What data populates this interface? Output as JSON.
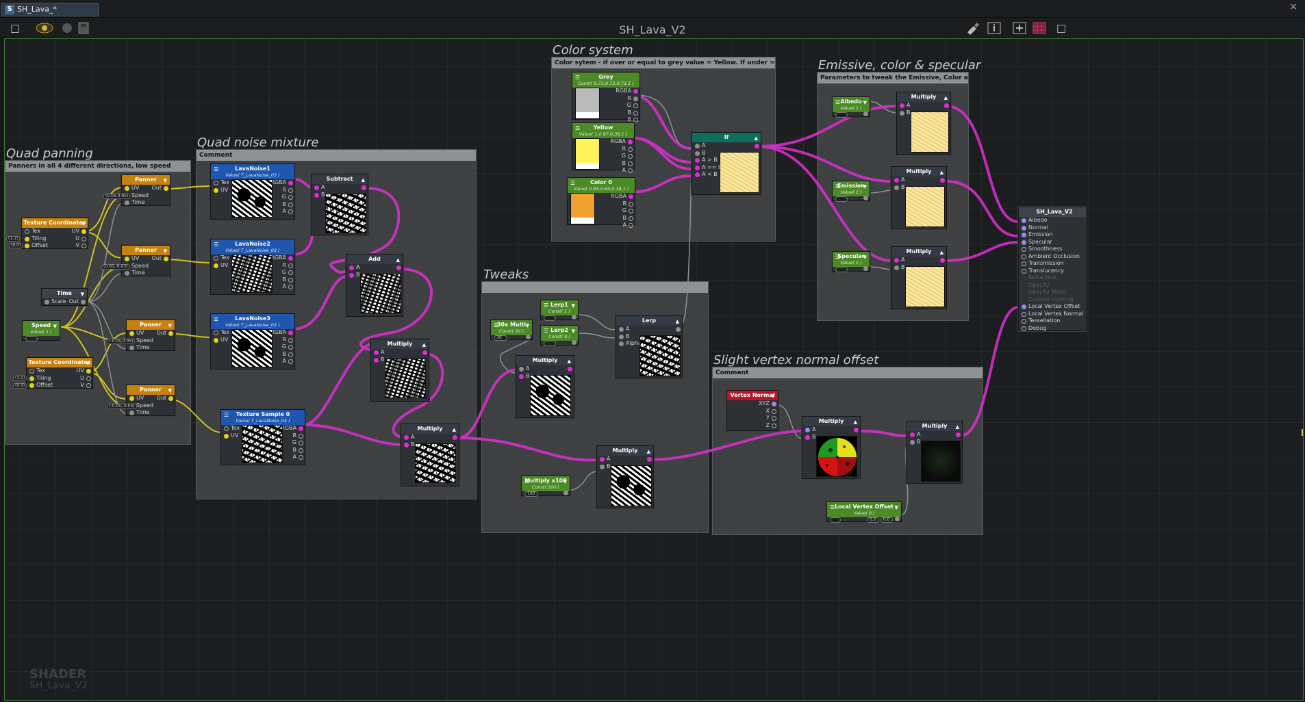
{
  "tab": {
    "label": "SH_Lava_*",
    "icon_letter": "S"
  },
  "window": {
    "close_glyph": "×"
  },
  "canvas_title": "SH_Lava_V2",
  "watermark": {
    "line1": "SHADER",
    "line2": "SH_Lava_V2"
  },
  "groups": {
    "quad_panning": {
      "title": "Quad panning",
      "comment": "Panners in all 4 different directions, low speed"
    },
    "quad_noise": {
      "title": "Quad noise mixture",
      "comment": "Comment"
    },
    "color_system": {
      "title": "Color system",
      "comment": "Color sytem - if over or equal to grey value = Yellow. If under = Orange"
    },
    "emissive": {
      "title": "Emissive, color & specular",
      "comment": "Parameters to tweak the Emissive, Color and Specular"
    },
    "tweaks": {
      "title": "Tweaks",
      "comment": ""
    },
    "vertex": {
      "title": "Slight vertex normal offset",
      "comment": "Comment"
    }
  },
  "nodes": {
    "texcoord1": {
      "title": "Texture Coordinates",
      "in": [
        "Tex",
        "Tiling",
        "Offset"
      ],
      "out": [
        "UV",
        "U",
        "V"
      ],
      "tags": [
        "(1,1)",
        "(0,0)"
      ]
    },
    "texcoord2": {
      "title": "Texture Coordinates",
      "in": [
        "Tex",
        "Tiling",
        "Offset"
      ],
      "out": [
        "UV",
        "U",
        "V"
      ],
      "tags": [
        "(1,1)",
        "(0,0)"
      ]
    },
    "time": {
      "title": "Time",
      "in": [
        "Scale"
      ],
      "out": [
        "Out"
      ]
    },
    "speed": {
      "title": "Speed",
      "sub": "Value( 1 )"
    },
    "panner1": {
      "title": "Panner",
      "in": [
        "UV",
        "Speed",
        "Time"
      ],
      "out": "Out",
      "tag": "(0.05,0.05)"
    },
    "panner2": {
      "title": "Panner",
      "in": [
        "UV",
        "Speed",
        "Time"
      ],
      "out": "Out",
      "tag": "(0.05,-0.05)"
    },
    "panner3": {
      "title": "Panner",
      "in": [
        "UV",
        "Speed",
        "Time"
      ],
      "out": "Out",
      "tag": "(-0.05,0.05)"
    },
    "panner4": {
      "title": "Panner",
      "in": [
        "UV",
        "Speed",
        "Time"
      ],
      "out": "Out",
      "tag": "(-0.05,-0.05)"
    },
    "lava1": {
      "title": "LavaNoise1",
      "sub": "Value( T_LavaNoise_03 )",
      "in": [
        "Tex",
        "UV"
      ],
      "out": [
        "RGBA",
        "R",
        "G",
        "B",
        "A"
      ]
    },
    "lava2": {
      "title": "LavaNoise2",
      "sub": "Value( T_LavaNoise_03 )",
      "in": [
        "Tex",
        "UV"
      ],
      "out": [
        "RGBA",
        "R",
        "G",
        "B",
        "A"
      ]
    },
    "lava3": {
      "title": "LavaNoise3",
      "sub": "Value( T_LavaNoise_03 )",
      "in": [
        "Tex",
        "UV"
      ],
      "out": [
        "RGBA",
        "R",
        "G",
        "B",
        "A"
      ]
    },
    "texsample0": {
      "title": "Texture Sample 0",
      "sub": "Value( T_LavaNoise_03 )",
      "in": [
        "Tex",
        "UV"
      ],
      "out": [
        "RGBA",
        "R",
        "G",
        "B",
        "A"
      ]
    },
    "subtract": {
      "title": "Subtract",
      "in": [
        "A",
        "B"
      ]
    },
    "add": {
      "title": "Add",
      "in": [
        "A",
        "B"
      ]
    },
    "multiply_noise1": {
      "title": "Multiply",
      "in": [
        "A",
        "B"
      ]
    },
    "multiply_noise2": {
      "title": "Multiply",
      "in": [
        "A",
        "B"
      ]
    },
    "grey": {
      "title": "Grey",
      "sub": "Const( 0.73,0.73,0.73,1 )",
      "out": [
        "RGBA",
        "R",
        "G",
        "B",
        "A"
      ]
    },
    "yellow": {
      "title": "Yellow",
      "sub": "Value( 1,0.97,0.36,1 )",
      "out": [
        "RGBA",
        "R",
        "G",
        "B",
        "A"
      ]
    },
    "color0": {
      "title": "Color 0",
      "sub": "Value( 0.93,0.63,0.18,1 )",
      "out": [
        "RGBA",
        "R",
        "G",
        "B",
        "A"
      ]
    },
    "if": {
      "title": "If",
      "in": [
        "A",
        "B",
        "A > B",
        "A == B",
        "A < B"
      ]
    },
    "albedo": {
      "title": "Albedo",
      "sub": "Value( 1 )"
    },
    "emission": {
      "title": "Emission",
      "sub": "Value( 1 )"
    },
    "specular": {
      "title": "Specular",
      "sub": "Value( 1 )"
    },
    "mul_albedo": {
      "title": "Multiply",
      "in": [
        "A",
        "B"
      ]
    },
    "mul_emission": {
      "title": "Multiply",
      "in": [
        "A",
        "B"
      ]
    },
    "mul_specular": {
      "title": "Multiply",
      "in": [
        "A",
        "B"
      ]
    },
    "output": {
      "title": "SH_Lava_V2",
      "in": [
        "Albedo",
        "Normal",
        "Emission",
        "Specular",
        "Smoothness",
        "Ambient Occlusion",
        "Transmission",
        "Translucency",
        "Refraction",
        "Opacity",
        "Opacity Mask",
        "Custom Lighting",
        "Local Vertex Offset",
        "Local Vertex Normal",
        "Tessellation",
        "Debug"
      ]
    },
    "mult30x": {
      "title": "30x Multi",
      "sub": "Const( 30 )",
      "tag": "30"
    },
    "lerp1": {
      "title": "Lerp1",
      "sub": "Const( 1 )"
    },
    "lerp2": {
      "title": "Lerp2",
      "sub": "Const( 0 )"
    },
    "lerp": {
      "title": "Lerp",
      "in": [
        "A",
        "B",
        "Alpha"
      ]
    },
    "multiply_tw1": {
      "title": "Multiply",
      "in": [
        "A",
        "B"
      ]
    },
    "multiply_tw2": {
      "title": "Multiply",
      "in": [
        "A",
        "B"
      ]
    },
    "multx100": {
      "title": "Multiply x100",
      "sub": "Const( 100 )",
      "tag": "100"
    },
    "vertexnormal": {
      "title": "Vertex Normal",
      "out": [
        "XYZ",
        "X",
        "Y",
        "Z"
      ]
    },
    "mul_vn1": {
      "title": "Multiply",
      "in": [
        "A",
        "B"
      ]
    },
    "mul_vn2": {
      "title": "Multiply",
      "in": [
        "A",
        "B"
      ]
    },
    "lvo": {
      "title": "Local Vertex Offset",
      "sub": "Value( 0 )",
      "tags": [
        "0.0",
        "0.0"
      ]
    }
  },
  "colors": {
    "wire_yellow": "#e3d11f",
    "wire_magenta": "#dd2fd3",
    "wire_grey": "#8f9296",
    "canvas_border": "#3c7a3c"
  }
}
